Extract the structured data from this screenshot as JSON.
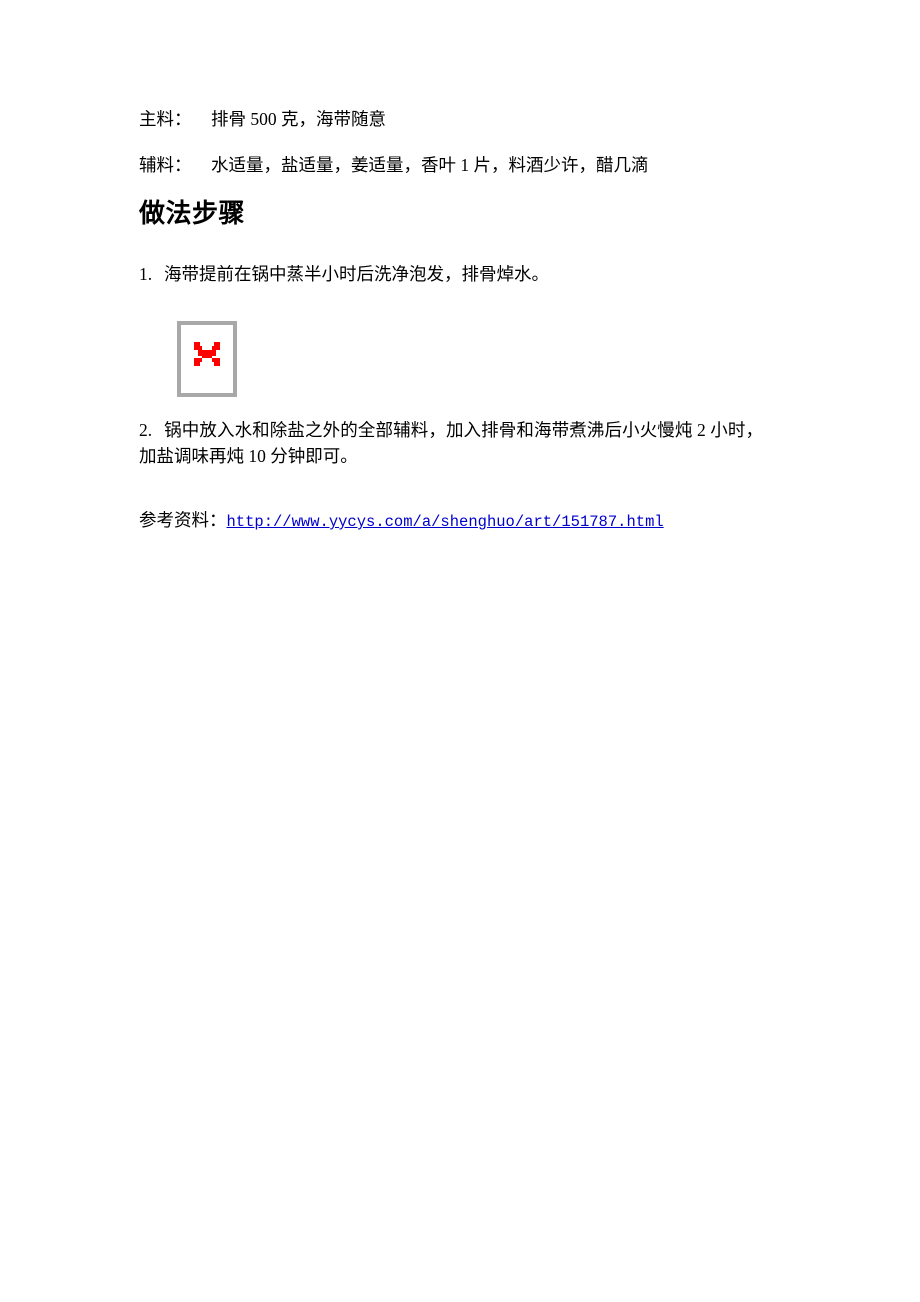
{
  "document": {
    "background_color": "#ffffff",
    "text_color": "#000000",
    "link_color": "#0000cc"
  },
  "ingredients": [
    {
      "label": "主料：",
      "value": "排骨 500 克，海带随意"
    },
    {
      "label": "辅料：",
      "value": "水适量，盐适量，姜适量，香叶 1 片，料酒少许，醋几滴"
    }
  ],
  "section": {
    "heading": "做法步骤"
  },
  "steps": [
    {
      "number": "1.",
      "text": "海带提前在锅中蒸半小时后洗净泡发，排骨焯水。"
    },
    {
      "number": "2.",
      "text": "锅中放入水和除盐之外的全部辅料，加入排骨和海带煮沸后小火慢炖 2 小时，加盐调味再炖 10 分钟即可。"
    }
  ],
  "broken_image": {
    "alt": "",
    "frame_color": "#a8a8a8",
    "shadow_color": "#000000",
    "fill_color": "#ffffff",
    "x_color": "#ff0000"
  },
  "reference": {
    "label": "参考资料：",
    "url": "http://www.yycys.com/a/shenghuo/art/151787.html"
  }
}
